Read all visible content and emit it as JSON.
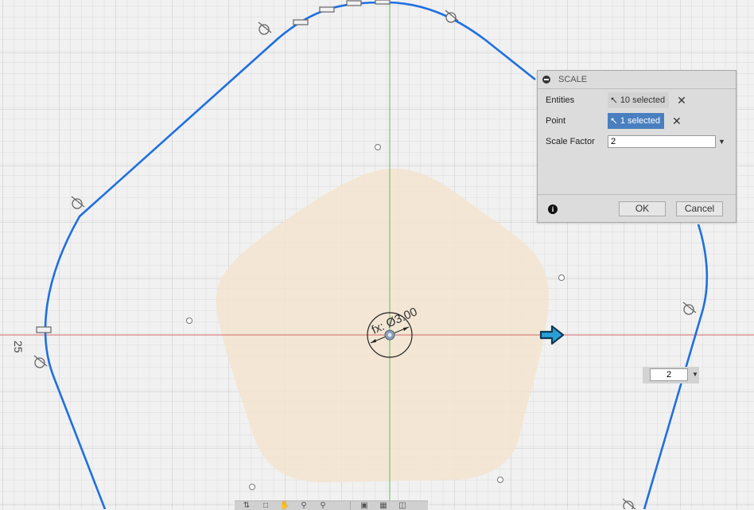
{
  "sketch": {
    "dimension_text": "fx: Ø3.00",
    "left_dimension": "25",
    "colors": {
      "profile": "#1f6fe0",
      "fill": "#f1e3cf",
      "x_axis": "#d36a6a",
      "y_axis": "#5abf5a",
      "grid": "#d8d8d8"
    }
  },
  "dialog": {
    "title": "SCALE",
    "entities": {
      "label": "Entities",
      "value": "10 selected"
    },
    "point": {
      "label": "Point",
      "value": "1 selected"
    },
    "scale_factor": {
      "label": "Scale Factor",
      "value": "2"
    },
    "ok_label": "OK",
    "cancel_label": "Cancel",
    "info_glyph": "i"
  },
  "floating_input": {
    "value": "2"
  },
  "toolbar": {
    "icons": [
      "orbit-icon",
      "look-at-icon",
      "pan-icon",
      "zoom-icon",
      "fit-icon",
      "display-icon",
      "grid-icon",
      "viewports-icon"
    ]
  }
}
